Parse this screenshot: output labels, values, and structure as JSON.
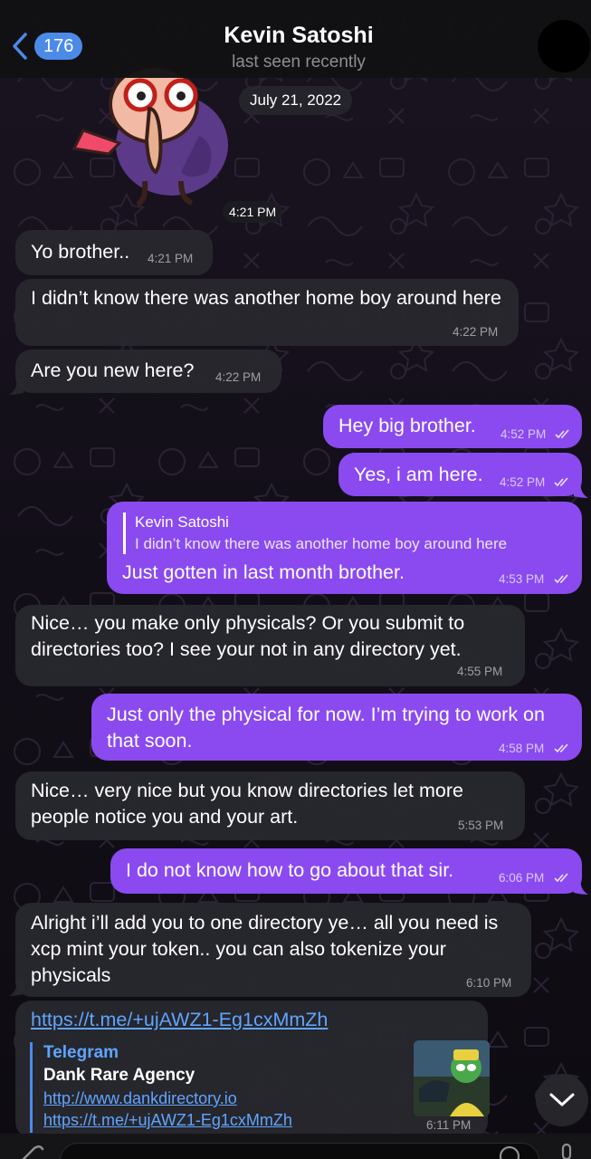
{
  "header": {
    "back_badge": "176",
    "name": "Kevin Satoshi",
    "status": "last seen recently"
  },
  "date_divider": "July 21, 2022",
  "sticker_time": "4:21 PM",
  "messages": [
    {
      "dir": "in",
      "text": "Yo brother..",
      "time": "4:21 PM"
    },
    {
      "dir": "in",
      "text": "I didn’t know there was another home boy around here",
      "time": "4:22 PM"
    },
    {
      "dir": "in",
      "text": "Are you new here?",
      "time": "4:22 PM"
    },
    {
      "dir": "out",
      "text": "Hey big brother.",
      "time": "4:52 PM"
    },
    {
      "dir": "out",
      "text": "Yes, i am here.",
      "time": "4:52 PM"
    },
    {
      "dir": "out",
      "reply_name": "Kevin Satoshi",
      "reply_text": "I didn’t know there was another home boy around here",
      "text": "Just gotten in last month brother.",
      "time": "4:53 PM"
    },
    {
      "dir": "in",
      "text": "Nice… you make only physicals? Or you submit to directories too? I see your not in any directory yet.",
      "time": "4:55 PM"
    },
    {
      "dir": "out",
      "text": "Just only the physical for now. I’m trying to work on that soon.",
      "time": "4:58 PM"
    },
    {
      "dir": "in",
      "text": "Nice… very nice but you know directories let more people notice you and your art.",
      "time": "5:53 PM"
    },
    {
      "dir": "out",
      "text": "I do not know how to go about that sir.",
      "time": "6:06 PM"
    },
    {
      "dir": "in",
      "text": "Alright i’ll add you to one directory ye… all you need is xcp mint your token.. you can also tokenize your physicals",
      "time": "6:10 PM"
    },
    {
      "dir": "in",
      "link": "https://t.me/+ujAWZ1-Eg1cxMmZh",
      "preview_site": "Telegram",
      "preview_title": "Dank Rare Agency",
      "preview_desc": "http://www.dankdirectory.io https://t.me/+ujAWZ1-Eg1cxMmZh",
      "time": "6:11 PM"
    }
  ],
  "colors": {
    "incoming_bubble": "#28282e",
    "outgoing_bubble": "#8a4af0",
    "accent": "#4c8ae8",
    "link": "#5fa5ff"
  },
  "icons": [
    "back-chevron-icon",
    "read-ticks-icon",
    "chevron-down-icon",
    "paperclip-icon",
    "sticker-icon",
    "microphone-icon"
  ]
}
